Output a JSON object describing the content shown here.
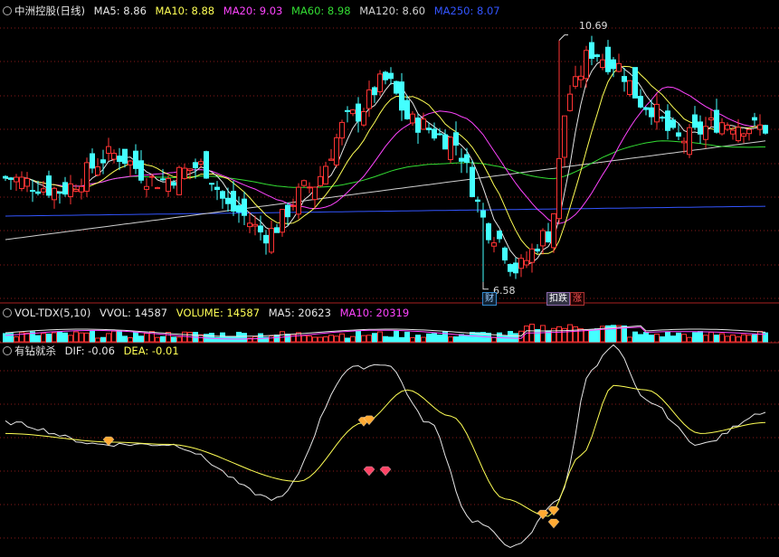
{
  "legend_main": {
    "title": "中洲控股(日线)",
    "items": [
      {
        "text": "MA5: 8.86",
        "color": "white"
      },
      {
        "text": "MA10: 8.88",
        "color": "yellow"
      },
      {
        "text": "MA20: 9.03",
        "color": "magenta"
      },
      {
        "text": "MA60: 8.98",
        "color": "green"
      },
      {
        "text": "MA120: 8.60",
        "color": "silver"
      },
      {
        "text": "MA250: 8.07",
        "color": "blue"
      }
    ]
  },
  "legend_vol": {
    "title": "VOL-TDX(5,10)",
    "items": [
      {
        "text": "VVOL: 14587",
        "color": "white"
      },
      {
        "text": "VOLUME: 14587",
        "color": "yellow"
      },
      {
        "text": "MA5: 20623",
        "color": "white"
      },
      {
        "text": "MA10: 20319",
        "color": "magenta"
      }
    ]
  },
  "legend_macd": {
    "title": "有钻就杀",
    "items": [
      {
        "text": "DIF: -0.06",
        "color": "white"
      },
      {
        "text": "DEA: -0.01",
        "color": "yellow"
      }
    ]
  },
  "annotations": {
    "high": "10.69",
    "low": "6.58",
    "tag_cai": "财",
    "tag_die": "扣跌",
    "tag_zhang": "涨"
  },
  "colors": {
    "background": "#000000",
    "up": "#ff3333",
    "down": "#44ffff",
    "grid": "#8a1a1a",
    "ma5": "#e6e6e6",
    "ma10": "#ffff55",
    "ma20": "#ff44ff",
    "ma60": "#33dd33",
    "ma120": "#d0d0d0",
    "ma250": "#3355ff",
    "diamond": "#ffaa33",
    "diamond_red": "#ff4466"
  },
  "chart_data": {
    "type": "candlestick",
    "price_range": [
      6.3,
      11.1
    ],
    "high_value": 10.69,
    "low_value": 6.58,
    "close_anchors": [
      [
        0,
        8.35
      ],
      [
        10,
        8.15
      ],
      [
        20,
        8.75
      ],
      [
        28,
        8.3
      ],
      [
        36,
        8.55
      ],
      [
        42,
        7.8
      ],
      [
        48,
        7.4
      ],
      [
        56,
        8.2
      ],
      [
        64,
        9.4
      ],
      [
        70,
        10.0
      ],
      [
        75,
        9.3
      ],
      [
        82,
        9.0
      ],
      [
        90,
        7.4
      ],
      [
        94,
        6.8
      ],
      [
        100,
        7.4
      ],
      [
        104,
        9.8
      ],
      [
        108,
        10.5
      ],
      [
        112,
        10.3
      ],
      [
        118,
        9.6
      ],
      [
        124,
        9.0
      ],
      [
        132,
        9.3
      ],
      [
        140,
        9.2
      ]
    ],
    "volume_note": "volume histogram, up bars red outline, down bars cyan",
    "macd": {
      "dif_anchors": [
        [
          0,
          0.05
        ],
        [
          18,
          -0.05
        ],
        [
          30,
          -0.05
        ],
        [
          50,
          -0.3
        ],
        [
          64,
          0.3
        ],
        [
          70,
          0.32
        ],
        [
          78,
          0.05
        ],
        [
          86,
          -0.4
        ],
        [
          94,
          -0.52
        ],
        [
          102,
          -0.3
        ],
        [
          108,
          0.3
        ],
        [
          112,
          0.4
        ],
        [
          118,
          0.15
        ],
        [
          128,
          -0.05
        ],
        [
          140,
          0.1
        ]
      ],
      "dea_anchors": [
        [
          0,
          0.0
        ],
        [
          20,
          -0.04
        ],
        [
          30,
          -0.05
        ],
        [
          54,
          -0.22
        ],
        [
          66,
          0.05
        ],
        [
          74,
          0.2
        ],
        [
          82,
          0.08
        ],
        [
          92,
          -0.3
        ],
        [
          100,
          -0.38
        ],
        [
          106,
          -0.1
        ],
        [
          112,
          0.22
        ],
        [
          118,
          0.2
        ],
        [
          128,
          0.0
        ],
        [
          140,
          0.05
        ]
      ],
      "y_range": [
        -0.55,
        0.35
      ]
    },
    "signals": [
      {
        "bar": 19,
        "kind": "gold"
      },
      {
        "bar": 66,
        "kind": "gold"
      },
      {
        "bar": 67,
        "kind": "gold"
      },
      {
        "bar": 67,
        "kind": "red"
      },
      {
        "bar": 70,
        "kind": "red"
      },
      {
        "bar": 99,
        "kind": "gold"
      },
      {
        "bar": 101,
        "kind": "gold"
      },
      {
        "bar": 101,
        "kind": "gold"
      }
    ]
  }
}
